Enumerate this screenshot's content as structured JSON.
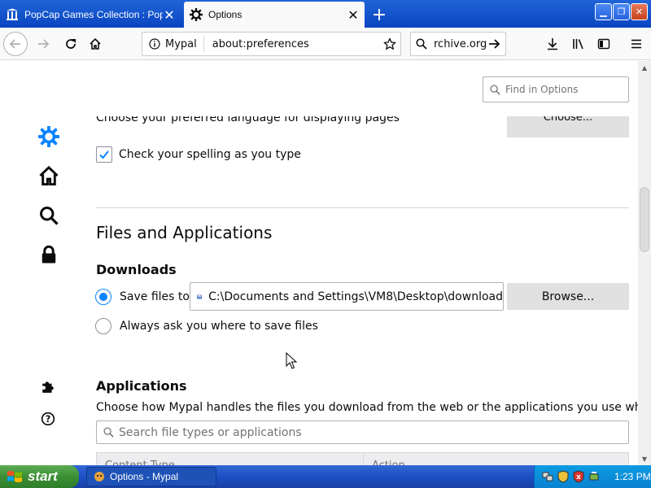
{
  "tabs": [
    {
      "title": "PopCap Games Collection : PopCap Games Collection",
      "active": false,
      "icon": "library-columns-icon"
    },
    {
      "title": "Options",
      "active": true,
      "icon": "gear-icon"
    }
  ],
  "urlbar": {
    "identity": "Mypal",
    "url": "about:preferences"
  },
  "searchbar": {
    "text": "rchive.org"
  },
  "find_options": {
    "placeholder": "Find in Options"
  },
  "categories": [
    "general",
    "home",
    "search",
    "privacy",
    "extensions",
    "support"
  ],
  "language": {
    "text": "Choose your preferred language for displaying pages",
    "button": "Choose..."
  },
  "spelling": {
    "label": "Check your spelling as you type",
    "checked": true
  },
  "files_section": {
    "heading": "Files and Applications",
    "downloads_heading": "Downloads",
    "save_label": "Save files to",
    "save_selected": true,
    "path": "C:\\Documents and Settings\\VM8\\Desktop\\download",
    "browse_label": "Browse...",
    "ask_label": "Always ask you where to save files"
  },
  "applications": {
    "heading": "Applications",
    "description": "Choose how Mypal handles the files you download from the web or the applications you use while browsing.",
    "search_placeholder": "Search file types or applications",
    "columns": [
      "Content Type",
      "Action"
    ]
  },
  "taskbar": {
    "start_label": "start",
    "task_label": "Options - Mypal",
    "clock": "1:23 PM"
  },
  "colors": {
    "accent": "#0a84ff",
    "titlebar": "#0a45c1",
    "taskbar": "#1d4fc4",
    "start": "#3c8f34"
  }
}
